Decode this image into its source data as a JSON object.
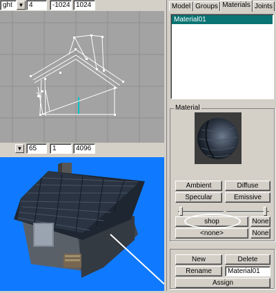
{
  "top_toolbar": {
    "view_value": "ght",
    "grid_value": "4",
    "min_value": "-1024",
    "max_value": "1024"
  },
  "mid_toolbar": {
    "value_a": "65",
    "value_b": "1",
    "value_c": "4096"
  },
  "tabs": [
    {
      "label": "Model"
    },
    {
      "label": "Groups"
    },
    {
      "label": "Materials"
    },
    {
      "label": "Joints"
    }
  ],
  "materials_list": {
    "items": [
      "Material01"
    ]
  },
  "material_panel": {
    "title": "Material",
    "ambient_label": "Ambient",
    "diffuse_label": "Diffuse",
    "specular_label": "Specular",
    "emissive_label": "Emissive",
    "texture_label": "shop",
    "none_label_1": "None",
    "alpha_label": "<none>",
    "none_label_2": "None"
  },
  "bottom_panel": {
    "new_label": "New",
    "delete_label": "Delete",
    "rename_label": "Rename",
    "name_value": "Material01",
    "assign_label": "Assign"
  },
  "colors": {
    "panel_bg": "#d4d0c8",
    "viewport_2d_bg": "#a3a3a3",
    "viewport_3d_bg": "#0f7aff",
    "selection": "#0a7373"
  }
}
